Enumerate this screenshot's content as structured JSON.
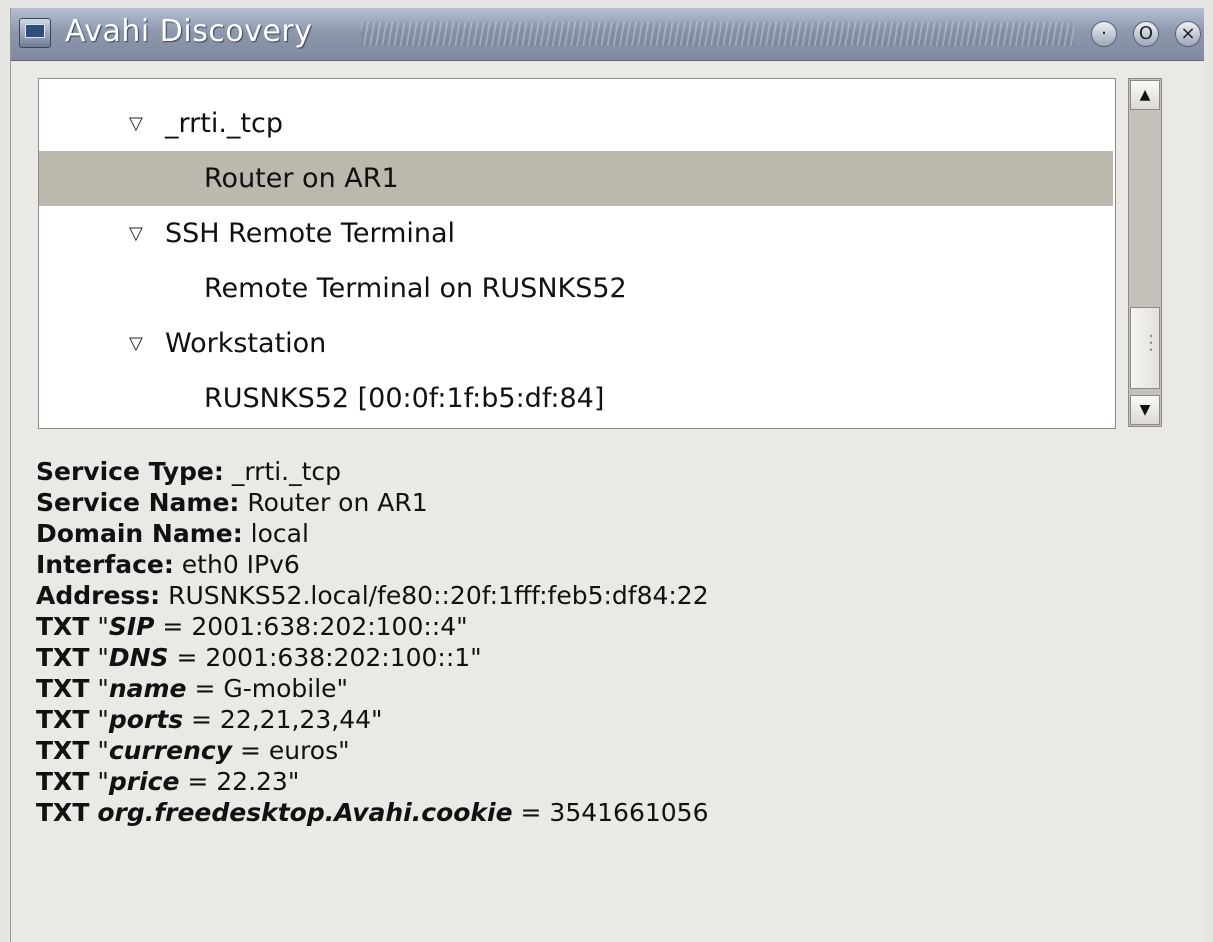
{
  "window": {
    "title": "Avahi Discovery",
    "buttons": {
      "minimize": "·",
      "maximize": "O",
      "close": "×"
    }
  },
  "tree": {
    "rows": [
      {
        "expander": "▽",
        "label": "_rrti._tcp"
      },
      {
        "label": "Router on AR1",
        "selected": true
      },
      {
        "expander": "▽",
        "label": "SSH Remote Terminal"
      },
      {
        "label": "Remote Terminal on RUSNKS52"
      },
      {
        "expander": "▽",
        "label": "Workstation"
      },
      {
        "label": "RUSNKS52 [00:0f:1f:b5:df:84]"
      }
    ]
  },
  "scrollbar": {
    "up": "▲",
    "down": "▼"
  },
  "details": {
    "service_type": {
      "label": "Service Type:",
      "value": " _rrti._tcp"
    },
    "service_name": {
      "label": "Service Name:",
      "value": " Router on AR1"
    },
    "domain_name": {
      "label": "Domain Name:",
      "value": " local"
    },
    "interface": {
      "label": "Interface:",
      "value": " eth0 IPv6"
    },
    "address": {
      "label": "Address:",
      "value": " RUSNKS52.local/fe80::20f:1fff:feb5:df84:22"
    },
    "txt": [
      {
        "prefix": "TXT",
        "open": " \"",
        "key": "SIP",
        "rest": " = 2001:638:202:100::4\""
      },
      {
        "prefix": "TXT",
        "open": " \"",
        "key": "DNS",
        "rest": " = 2001:638:202:100::1\""
      },
      {
        "prefix": "TXT",
        "open": " \"",
        "key": "name",
        "rest": " = G-mobile\""
      },
      {
        "prefix": "TXT",
        "open": " \"",
        "key": "ports",
        "rest": " = 22,21,23,44\""
      },
      {
        "prefix": "TXT",
        "open": " \"",
        "key": "currency",
        "rest": " = euros\""
      },
      {
        "prefix": "TXT",
        "open": " \"",
        "key": "price",
        "rest": " = 22.23\""
      },
      {
        "prefix": "TXT",
        "open": " ",
        "key": "org.freedesktop.Avahi.cookie",
        "rest": " = 3541661056"
      }
    ]
  }
}
